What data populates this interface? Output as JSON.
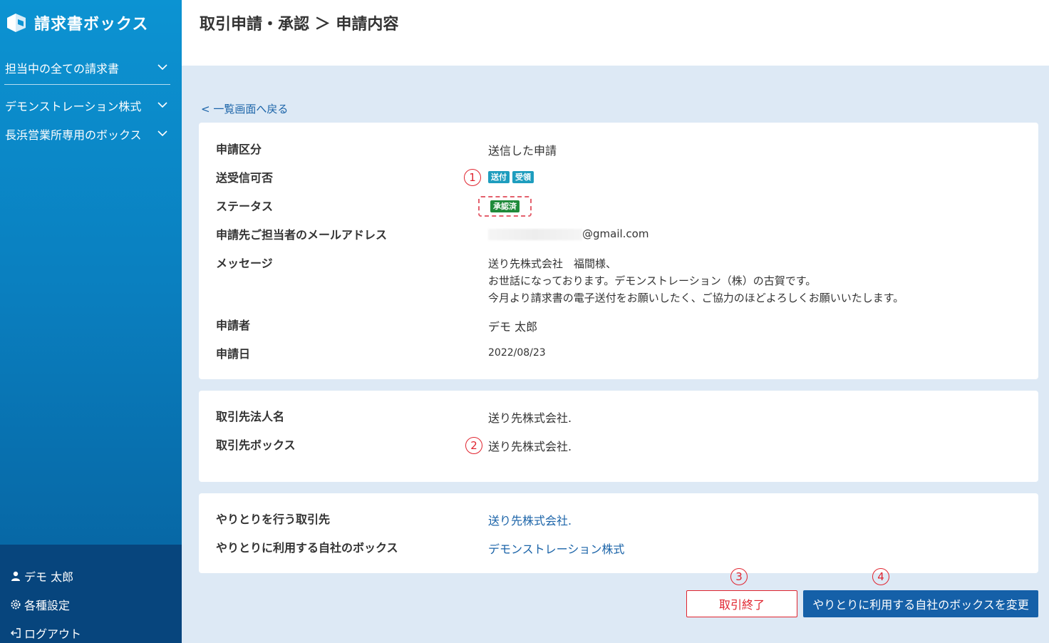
{
  "app": {
    "name": "請求書ボックス"
  },
  "sidebar": {
    "items": [
      {
        "label": "担当中の全ての請求書"
      },
      {
        "label": "デモンストレーション株式"
      },
      {
        "label": "長浜営業所専用のボックス"
      }
    ],
    "bottom": {
      "user": "デモ 太郎",
      "settings": "各種設定",
      "logout": "ログアウト"
    }
  },
  "header": {
    "title": "取引申請・承認 ＞ 申請内容"
  },
  "back_link": "< 一覧画面へ戻る",
  "detail": {
    "request_type": {
      "label": "申請区分",
      "value": "送信した申請"
    },
    "send_receive": {
      "label": "送受信可否",
      "badges": [
        "送付",
        "受領"
      ]
    },
    "status": {
      "label": "ステータス",
      "badge": "承認済"
    },
    "email": {
      "label": "申請先ご担当者のメールアドレス",
      "domain": "@gmail.com"
    },
    "message": {
      "label": "メッセージ",
      "lines": [
        "送り先株式会社　福間様、",
        "お世話になっております。デモンストレーション（株）の古賀です。",
        "今月より請求書の電子送付をお願いしたく、ご協力のほどよろしくお願いいたします。"
      ]
    },
    "applicant": {
      "label": "申請者",
      "value": "デモ 太郎"
    },
    "date": {
      "label": "申請日",
      "value": "2022/08/23"
    }
  },
  "partner": {
    "corp_name": {
      "label": "取引先法人名",
      "value": "送り先株式会社."
    },
    "box": {
      "label": "取引先ボックス",
      "value": "送り先株式会社."
    }
  },
  "exchange": {
    "partner": {
      "label": "やりとりを行う取引先",
      "value": "送り先株式会社."
    },
    "own_box": {
      "label": "やりとりに利用する自社のボックス",
      "value": "デモンストレーション株式"
    }
  },
  "annotations": {
    "n1": "1",
    "n2": "2",
    "n3": "3",
    "n4": "4"
  },
  "buttons": {
    "end": "取引終了",
    "change": "やりとりに利用する自社のボックスを変更"
  },
  "colors": {
    "accent": "#1560a8",
    "danger": "#e0242f",
    "badge_teal": "#1e9dbe",
    "badge_green": "#1f8a3a"
  }
}
